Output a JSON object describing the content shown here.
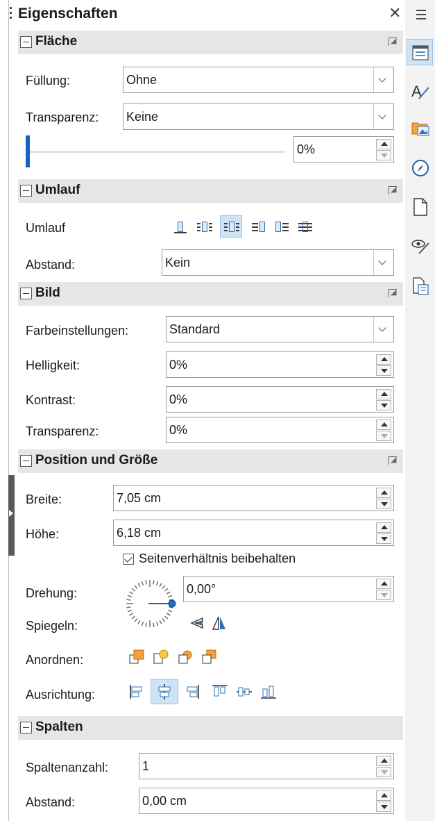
{
  "deck": {
    "title": "Eigenschaften"
  },
  "flaeche": {
    "title": "Fläche",
    "fill_label": "Füllung:",
    "fill_value": "Ohne",
    "transparency_label": "Transparenz:",
    "transparency_value": "Keine",
    "transparency_percent": "0%",
    "slider_level": 0
  },
  "umlauf": {
    "title": "Umlauf",
    "wrap_label": "Umlauf",
    "wrap_options": [
      "wrap-none-icon",
      "wrap-parallel-icon",
      "wrap-optimal-icon",
      "wrap-before-icon",
      "wrap-after-icon",
      "wrap-through-icon"
    ],
    "wrap_selected": 2,
    "spacing_label": "Abstand:",
    "spacing_value": "Kein"
  },
  "bild": {
    "title": "Bild",
    "color_label": "Farbeinstellungen:",
    "color_value": "Standard",
    "brightness_label": "Helligkeit:",
    "brightness_value": "0%",
    "contrast_label": "Kontrast:",
    "contrast_value": "0%",
    "transparency_label": "Transparenz:",
    "transparency_value": "0%"
  },
  "position": {
    "title": "Position und Größe",
    "width_label": "Breite:",
    "width_value": "7,05 cm",
    "height_label": "Höhe:",
    "height_value": "6,18 cm",
    "keep_ratio_label": "Seitenverhältnis beibehalten",
    "keep_ratio_checked": true,
    "rotation_label": "Drehung:",
    "rotation_value": "0,00°",
    "flip_label": "Spiegeln:",
    "arrange_label": "Anordnen:",
    "align_label": "Ausrichtung:",
    "align_selected": 1
  },
  "spalten": {
    "title": "Spalten",
    "count_label": "Spaltenanzahl:",
    "count_value": "1",
    "spacing_label": "Abstand:",
    "spacing_value": "0,00 cm"
  },
  "sidebar_tabs": [
    "properties-icon",
    "styles-icon",
    "gallery-icon",
    "navigator-icon",
    "page-icon",
    "style-inspector-icon",
    "manage-changes-icon"
  ],
  "colors": {
    "accent": "#1565c0",
    "header_bg": "#e6e6e6",
    "selected_bg": "#cfe3f7"
  }
}
